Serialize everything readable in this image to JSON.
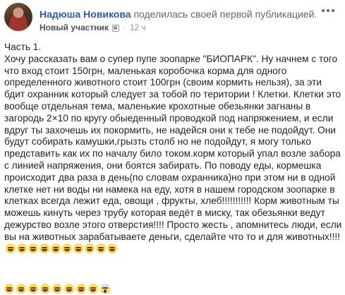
{
  "post": {
    "author": "Надюша Новикова",
    "action": "поделилась своей первой публикацией.",
    "badge": "Новый участник",
    "separator": "·",
    "time": "12 ч",
    "text": "Часть 1.\nХочу рассказать вам о супер пупе зоопарке \"БИОПАРК\". Ну начнем с того что вход стоит 150грн, маленькая коробочка корма для одного определенного животного стоит 100грн (своим кормить нельзя), за эти бдит охранник который следует за тобой по територии ! Клетки. Клетки это вообще отдельная тема, маленькие крохотные обезьянки загнаны в загородь 2×10 по кругу обыеденный проводкой под напряжением, и если вдруг ты захочешь их покормить, не надейся они к тебе не подойдут. Они будут собирать камушки,грызть столб но не подойдут, я могу только представить как их по началу било током.корм который упал возле забора с линией напряжения, они боятся забирать. По поводу еды, кормешка происходит два раза в день(по словам охранника)но при этом ни в одной клетке нет ни воды ни намека на еду, хотя в нашем городском зоопарке в клетках всегда лежит еда, овощи , фрукты, хлеб!!!!!!!!!!! Корм животным ты можешь кинуть через трубу которая ведёт в миску, так обезьянки ведут дежурство возле этого отверстия!!!! Просто жесть , апомнитесь люди, если вы на животных зарабатываете деньги, сделайте что то и для животных!!!!",
    "emojis": [
      "crying-face",
      "crying-face",
      "crying-face",
      "crying-face",
      "crying-face",
      "crying-face",
      "crying-face",
      "crying-face",
      "screaming-face"
    ],
    "inline_emojis": [
      "crying-face",
      "crying-face",
      "crying-face",
      "crying-face",
      "crying-face",
      "crying-face",
      "crying-face",
      "crying-face",
      "crying-face",
      "crying-face"
    ]
  }
}
